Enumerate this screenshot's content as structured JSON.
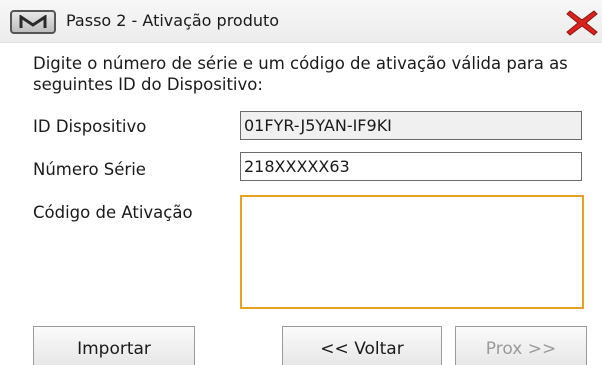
{
  "window": {
    "title": "Passo 2 - Ativação produto",
    "app_icon": "m-logo-icon",
    "close_icon": "close-x-icon"
  },
  "instruction": "Digite o número de série e um código de ativação válida para as seguintes ID do Dispositivo:",
  "fields": {
    "device_id": {
      "label": "ID Dispositivo",
      "value": "01FYR-J5YAN-IF9KI"
    },
    "serial_number": {
      "label": "Número Série",
      "value": "218XXXXX63"
    },
    "activation_code": {
      "label": "Código de Ativação",
      "value": ""
    }
  },
  "buttons": {
    "import": "Importar",
    "back": "<< Voltar",
    "next": "Prox >>"
  },
  "colors": {
    "close_red": "#d9231c",
    "focus_orange": "#e8a020",
    "disabled_text": "#9a9a9a"
  }
}
